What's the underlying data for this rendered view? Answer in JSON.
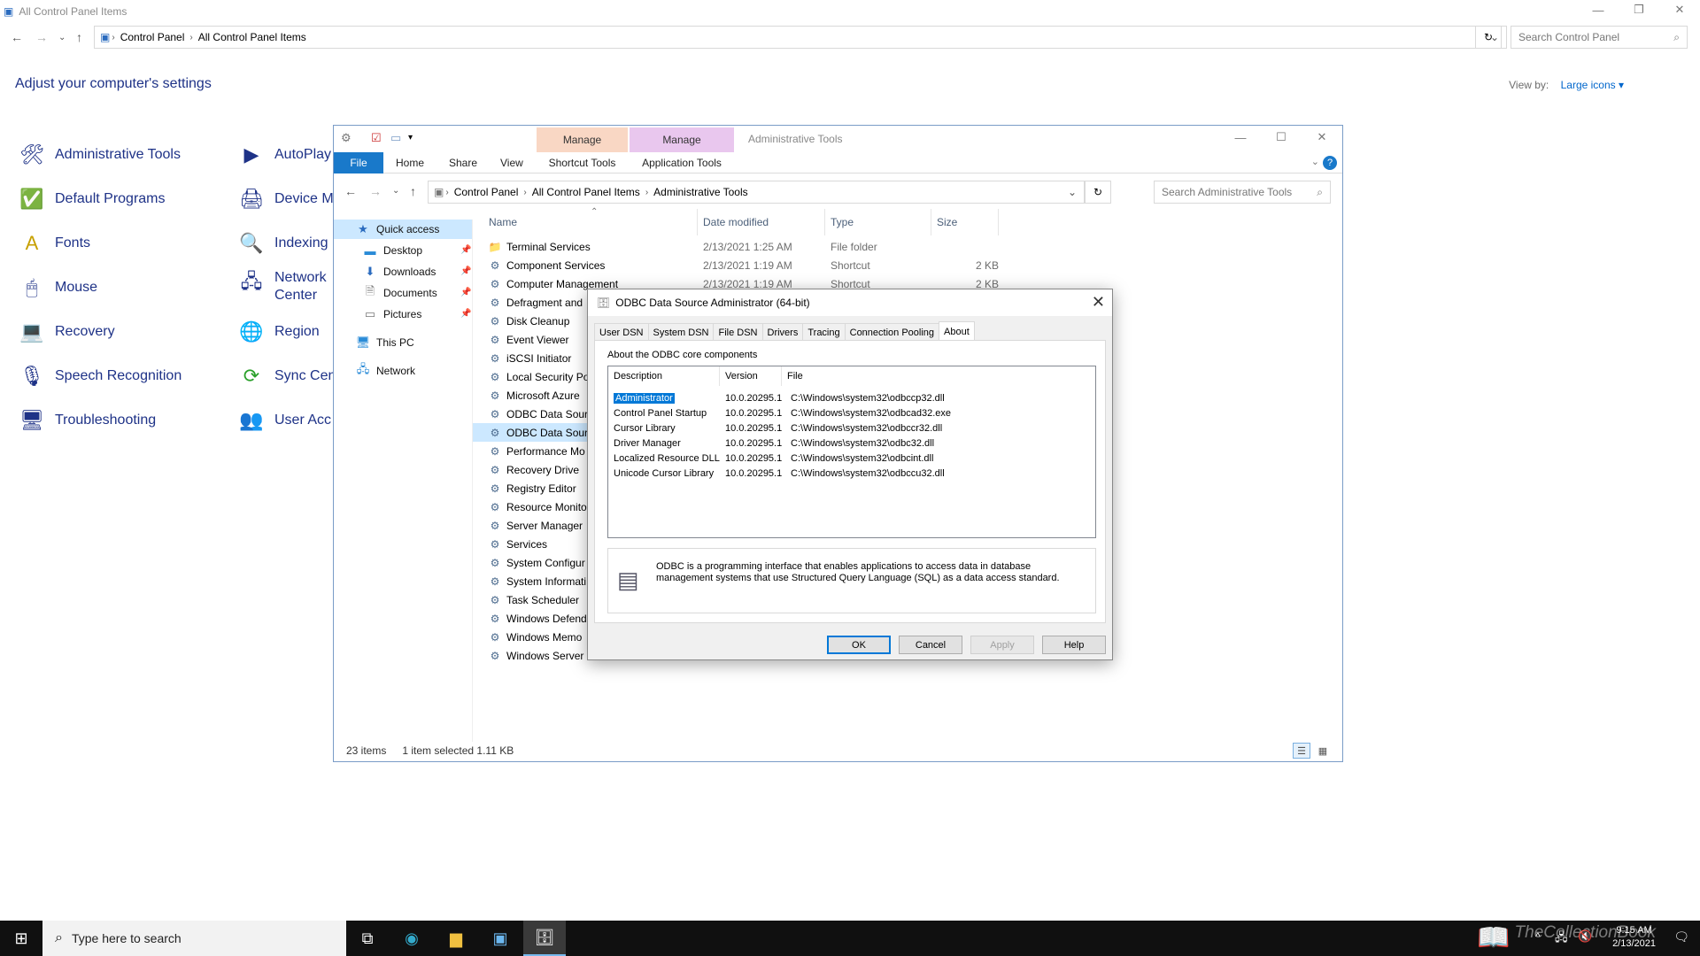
{
  "control_panel": {
    "title": "All Control Panel Items",
    "breadcrumb": [
      "Control Panel",
      "All Control Panel Items"
    ],
    "search_placeholder": "Search Control Panel",
    "heading": "Adjust your computer's settings",
    "view_by_label": "View by:",
    "view_by_value": "Large icons",
    "items": [
      {
        "label": "Administrative Tools",
        "icon": "admin-tools-icon"
      },
      {
        "label": "Default Programs",
        "icon": "default-programs-icon"
      },
      {
        "label": "Fonts",
        "icon": "fonts-icon"
      },
      {
        "label": "Mouse",
        "icon": "mouse-icon"
      },
      {
        "label": "Recovery",
        "icon": "recovery-icon"
      },
      {
        "label": "Speech Recognition",
        "icon": "microphone-icon"
      },
      {
        "label": "Troubleshooting",
        "icon": "troubleshooting-icon"
      },
      {
        "label": "AutoPlay",
        "icon": "autoplay-icon"
      },
      {
        "label": "Device M",
        "icon": "device-manager-icon"
      },
      {
        "label": "Indexing",
        "icon": "indexing-icon"
      },
      {
        "label": "Network",
        "label2": "Center",
        "icon": "network-icon"
      },
      {
        "label": "Region",
        "icon": "region-icon"
      },
      {
        "label": "Sync Cen",
        "icon": "sync-icon"
      },
      {
        "label": "User Acc",
        "icon": "user-accounts-icon"
      }
    ]
  },
  "explorer": {
    "title": "Administrative Tools",
    "context_tabs": [
      {
        "group": "Manage",
        "label": "Shortcut Tools",
        "color": "#f9d7c4"
      },
      {
        "group": "Manage",
        "label": "Application Tools",
        "color": "#e9c7ee"
      }
    ],
    "ribbon_tabs": [
      "File",
      "Home",
      "Share",
      "View"
    ],
    "breadcrumb": [
      "Control Panel",
      "All Control Panel Items",
      "Administrative Tools"
    ],
    "search_placeholder": "Search Administrative Tools",
    "nav": [
      {
        "label": "Quick access",
        "icon": "star-icon"
      },
      {
        "label": "Desktop",
        "icon": "desktop-icon"
      },
      {
        "label": "Downloads",
        "icon": "download-icon"
      },
      {
        "label": "Documents",
        "icon": "documents-icon"
      },
      {
        "label": "Pictures",
        "icon": "pictures-icon"
      },
      {
        "label": "This PC",
        "icon": "computer-icon"
      },
      {
        "label": "Network",
        "icon": "network-icon"
      }
    ],
    "columns": [
      "Name",
      "Date modified",
      "Type",
      "Size"
    ],
    "files": [
      {
        "name": "Terminal Services",
        "date": "2/13/2021 1:25 AM",
        "type": "File folder",
        "size": ""
      },
      {
        "name": "Component Services",
        "date": "2/13/2021 1:19 AM",
        "type": "Shortcut",
        "size": "2 KB"
      },
      {
        "name": "Computer Management",
        "date": "2/13/2021 1:19 AM",
        "type": "Shortcut",
        "size": "2 KB"
      },
      {
        "name": "Defragment and",
        "date": "",
        "type": "",
        "size": ""
      },
      {
        "name": "Disk Cleanup",
        "date": "",
        "type": "",
        "size": ""
      },
      {
        "name": "Event Viewer",
        "date": "",
        "type": "",
        "size": ""
      },
      {
        "name": "iSCSI Initiator",
        "date": "",
        "type": "",
        "size": ""
      },
      {
        "name": "Local Security Po",
        "date": "",
        "type": "",
        "size": ""
      },
      {
        "name": "Microsoft Azure",
        "date": "",
        "type": "",
        "size": ""
      },
      {
        "name": "ODBC Data Sour",
        "date": "",
        "type": "",
        "size": ""
      },
      {
        "name": "ODBC Data Sour",
        "date": "",
        "type": "",
        "size": ""
      },
      {
        "name": "Performance Mo",
        "date": "",
        "type": "",
        "size": ""
      },
      {
        "name": "Recovery Drive",
        "date": "",
        "type": "",
        "size": ""
      },
      {
        "name": "Registry Editor",
        "date": "",
        "type": "",
        "size": ""
      },
      {
        "name": "Resource Monito",
        "date": "",
        "type": "",
        "size": ""
      },
      {
        "name": "Server Manager",
        "date": "",
        "type": "",
        "size": ""
      },
      {
        "name": "Services",
        "date": "",
        "type": "",
        "size": ""
      },
      {
        "name": "System Configur",
        "date": "",
        "type": "",
        "size": ""
      },
      {
        "name": "System Informati",
        "date": "",
        "type": "",
        "size": ""
      },
      {
        "name": "Task Scheduler",
        "date": "",
        "type": "",
        "size": ""
      },
      {
        "name": "Windows Defend",
        "date": "",
        "type": "",
        "size": ""
      },
      {
        "name": "Windows Memo",
        "date": "",
        "type": "",
        "size": ""
      },
      {
        "name": "Windows Server",
        "date": "",
        "type": "",
        "size": ""
      }
    ],
    "status_count": "23 items",
    "status_selection": "1 item selected  1.11 KB"
  },
  "odbc": {
    "title": "ODBC Data Source Administrator (64-bit)",
    "tabs": [
      "User DSN",
      "System DSN",
      "File DSN",
      "Drivers",
      "Tracing",
      "Connection Pooling",
      "About"
    ],
    "active_tab": "About",
    "section_label": "About the ODBC core components",
    "columns": [
      "Description",
      "Version",
      "File"
    ],
    "components": [
      {
        "description": "Administrator",
        "version": "10.0.20295.1",
        "file": "C:\\Windows\\system32\\odbccp32.dll"
      },
      {
        "description": "Control Panel Startup",
        "version": "10.0.20295.1",
        "file": "C:\\Windows\\system32\\odbcad32.exe"
      },
      {
        "description": "Cursor Library",
        "version": "10.0.20295.1",
        "file": "C:\\Windows\\system32\\odbccr32.dll"
      },
      {
        "description": "Driver Manager",
        "version": "10.0.20295.1",
        "file": "C:\\Windows\\system32\\odbc32.dll"
      },
      {
        "description": "Localized Resource DLL",
        "version": "10.0.20295.1",
        "file": "C:\\Windows\\system32\\odbcint.dll"
      },
      {
        "description": "Unicode Cursor Library",
        "version": "10.0.20295.1",
        "file": "C:\\Windows\\system32\\odbccu32.dll"
      }
    ],
    "info": "ODBC is a programming interface that enables applications to access data in database management systems that use Structured Query Language (SQL) as a data access standard.",
    "buttons": {
      "ok": "OK",
      "cancel": "Cancel",
      "apply": "Apply",
      "help": "Help"
    }
  },
  "taskbar": {
    "search_placeholder": "Type here to search",
    "time": "9:15 AM",
    "date": "2/13/2021",
    "watermark": "TheCollectionBook"
  }
}
